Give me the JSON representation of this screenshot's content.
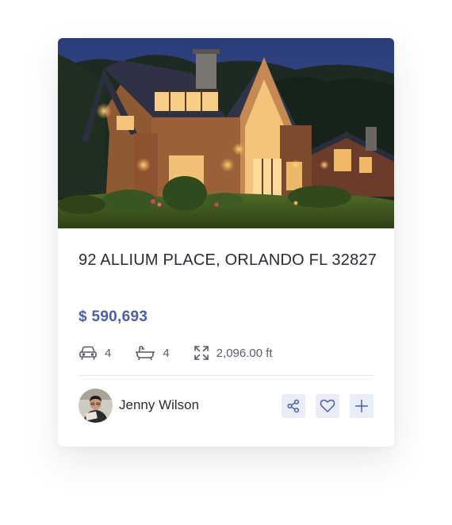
{
  "listing": {
    "address": "92 ALLIUM PLACE, ORLANDO FL 32827",
    "price": "$ 590,693",
    "photo_icon": "house-photo"
  },
  "features": {
    "garage_icon": "car-icon",
    "garage": "4",
    "bath_icon": "bathtub-icon",
    "baths": "4",
    "area_icon": "expand-icon",
    "area": "2,096.00 ft"
  },
  "agent": {
    "name": "Jenny Wilson",
    "avatar_icon": "avatar-photo"
  },
  "actions": {
    "share_icon": "share-icon",
    "favorite_icon": "heart-icon",
    "add_icon": "plus-icon"
  },
  "colors": {
    "price": "#4a5fa8",
    "icon": "#4a5fa8",
    "button_bg": "#e9edf7",
    "text": "#2b2d36",
    "muted": "#5a5d68"
  }
}
